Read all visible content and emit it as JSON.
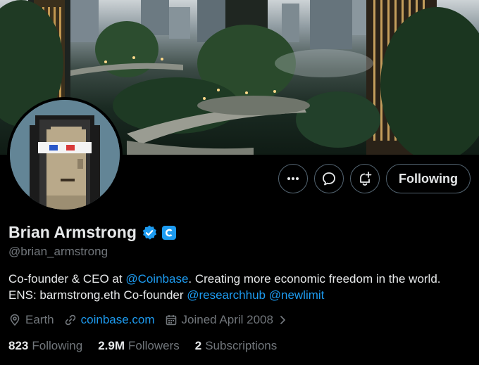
{
  "profile": {
    "name": "Brian Armstrong",
    "handle": "@brian_armstrong",
    "bio": {
      "line1_prefix": "Co-founder & CEO at ",
      "line1_mention": "@Coinbase",
      "line1_suffix": ". Creating more economic freedom in the world.",
      "line2_prefix": "ENS: barmstrong.eth Co-founder ",
      "line2_mention1": "@researchhub",
      "line2_mention2": "@newlimit"
    },
    "location": "Earth",
    "website": "coinbase.com",
    "joined": "Joined April 2008"
  },
  "actions": {
    "following_label": "Following"
  },
  "stats": {
    "following_count": "823",
    "following_label": "Following",
    "followers_count": "2.9M",
    "followers_label": "Followers",
    "subscriptions_count": "2",
    "subscriptions_label": "Subscriptions"
  },
  "icons": {
    "more": "more-icon",
    "message": "message-icon",
    "notify": "bell-plus-icon",
    "verified": "verified-badge-icon",
    "affiliate": "coinbase-badge-icon",
    "location": "location-pin-icon",
    "link": "link-icon",
    "calendar": "calendar-icon"
  },
  "colors": {
    "accent": "#1d9bf0",
    "background": "#000000",
    "muted": "#71767b",
    "text": "#e7e9ea"
  }
}
